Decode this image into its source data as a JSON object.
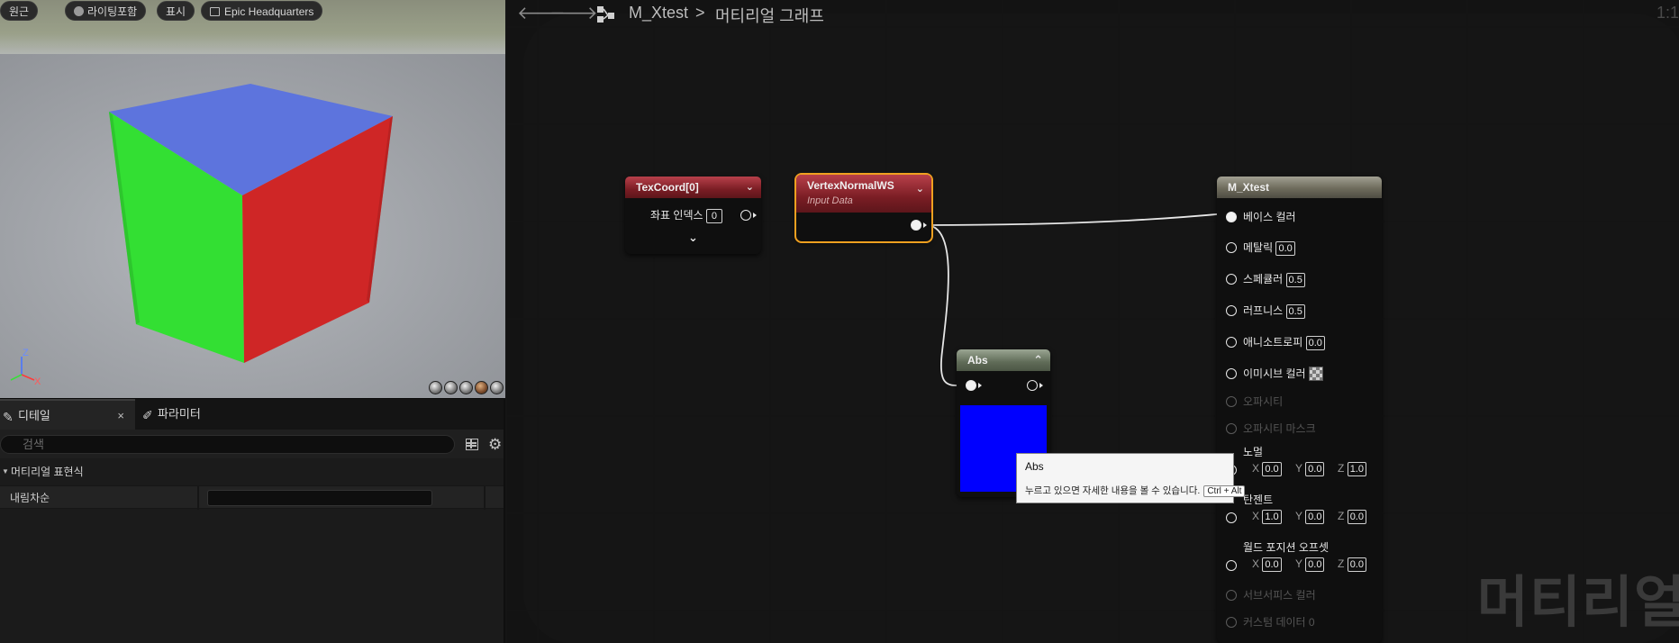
{
  "viewport": {
    "perspective_label": "원근",
    "lighting_label": "라이팅포함",
    "show_label": "표시",
    "preview_scene_label": "Epic Headquarters",
    "axis_z": "Z",
    "axis_x": "X"
  },
  "details": {
    "tabs": [
      {
        "label": "디테일",
        "icon": "pencil-icon"
      },
      {
        "label": "파라미터",
        "icon": "brush-icon"
      }
    ],
    "close_glyph": "×",
    "search_placeholder": "검색",
    "category_label": "머티리얼 표현식",
    "property_label": "내림차순"
  },
  "graph": {
    "breadcrumb_root": "M_Xtest",
    "breadcrumb_separator": ">",
    "breadcrumb_current": "머티리얼 그래프",
    "zoom_label": "1:1",
    "watermark": "머티리얼",
    "nodes": {
      "texcoord": {
        "title": "TexCoord[0]",
        "coord_label": "좌표 인덱스",
        "coord_value": "0"
      },
      "vertexnormal": {
        "title": "VertexNormalWS",
        "subtitle": "Input Data"
      },
      "abs": {
        "title": "Abs",
        "preview_color": "#0000ff"
      },
      "result": {
        "title": "M_Xtest",
        "base_color": "베이스 컬러",
        "metallic": "메탈릭",
        "metallic_value": "0.0",
        "specular": "스페큘러",
        "specular_value": "0.5",
        "roughness": "러프니스",
        "roughness_value": "0.5",
        "anisotropy": "애니소트로피",
        "anisotropy_value": "0.0",
        "emissive": "이미시브 컬러",
        "opacity": "오파시티",
        "opacity_mask": "오파시티 마스크",
        "normal": "노멀",
        "normal_x": "0.0",
        "normal_y": "0.0",
        "normal_z": "1.0",
        "tangent": "탄젠트",
        "tangent_x": "1.0",
        "tangent_y": "0.0",
        "tangent_z": "0.0",
        "wpo": "월드 포지션 오프셋",
        "wpo_x": "0.0",
        "wpo_y": "0.0",
        "wpo_z": "0.0",
        "subsurface": "서브서피스 컬러",
        "custom_data": "커스텀 데이터 0",
        "x": "X",
        "y": "Y",
        "z": "Z"
      }
    },
    "tooltip": {
      "title": "Abs",
      "description": "누르고 있으면 자세한 내용을 볼 수 있습니다.",
      "shortcut": "Ctrl + Alt"
    }
  },
  "colors": {
    "cube_top": "#5b74e0",
    "cube_left": "#2fe02f",
    "cube_right": "#d02525",
    "selection_outline": "#f0a020"
  }
}
